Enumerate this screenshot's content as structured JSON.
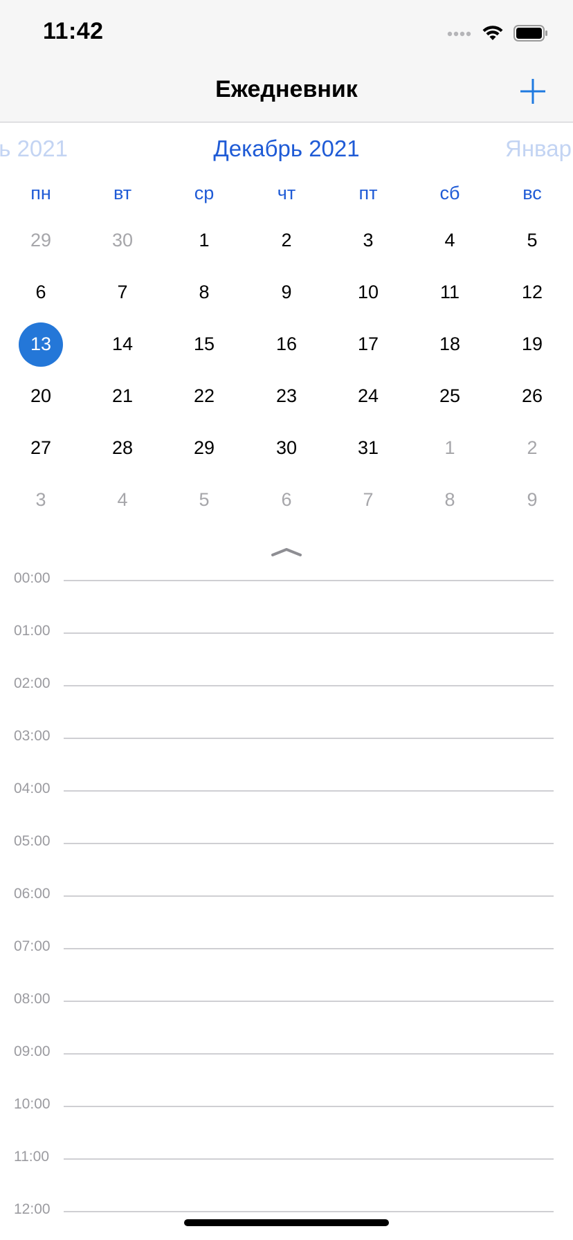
{
  "status_bar": {
    "time": "11:42",
    "icons": [
      "signal-dots-icon",
      "wifi-icon",
      "battery-icon"
    ]
  },
  "nav": {
    "title": "Ежедневник",
    "add_icon": "plus-icon"
  },
  "calendar": {
    "prev_month": "ь 2021",
    "current_month": "Декабрь 2021",
    "next_month": "Январь",
    "weekdays": [
      "пн",
      "вт",
      "ср",
      "чт",
      "пт",
      "сб",
      "вс"
    ],
    "weeks": [
      [
        {
          "d": "29",
          "m": true
        },
        {
          "d": "30",
          "m": true
        },
        {
          "d": "1"
        },
        {
          "d": "2"
        },
        {
          "d": "3"
        },
        {
          "d": "4"
        },
        {
          "d": "5"
        }
      ],
      [
        {
          "d": "6"
        },
        {
          "d": "7"
        },
        {
          "d": "8"
        },
        {
          "d": "9"
        },
        {
          "d": "10"
        },
        {
          "d": "11"
        },
        {
          "d": "12"
        }
      ],
      [
        {
          "d": "13",
          "s": true
        },
        {
          "d": "14"
        },
        {
          "d": "15"
        },
        {
          "d": "16"
        },
        {
          "d": "17"
        },
        {
          "d": "18"
        },
        {
          "d": "19"
        }
      ],
      [
        {
          "d": "20"
        },
        {
          "d": "21"
        },
        {
          "d": "22"
        },
        {
          "d": "23"
        },
        {
          "d": "24"
        },
        {
          "d": "25"
        },
        {
          "d": "26"
        }
      ],
      [
        {
          "d": "27"
        },
        {
          "d": "28"
        },
        {
          "d": "29"
        },
        {
          "d": "30"
        },
        {
          "d": "31"
        },
        {
          "d": "1",
          "m": true
        },
        {
          "d": "2",
          "m": true
        }
      ],
      [
        {
          "d": "3",
          "m": true
        },
        {
          "d": "4",
          "m": true
        },
        {
          "d": "5",
          "m": true
        },
        {
          "d": "6",
          "m": true
        },
        {
          "d": "7",
          "m": true
        },
        {
          "d": "8",
          "m": true
        },
        {
          "d": "9",
          "m": true
        }
      ]
    ],
    "collapse_icon": "chevron-up-icon"
  },
  "timeline": {
    "hours": [
      "00:00",
      "01:00",
      "02:00",
      "03:00",
      "04:00",
      "05:00",
      "06:00",
      "07:00",
      "08:00",
      "09:00",
      "10:00",
      "11:00",
      "12:00"
    ]
  },
  "colors": {
    "accent": "#1f5bd6",
    "selected_day": "#2477d8",
    "muted_text": "#a6a6aa",
    "faded_month": "#c3d4f3"
  }
}
